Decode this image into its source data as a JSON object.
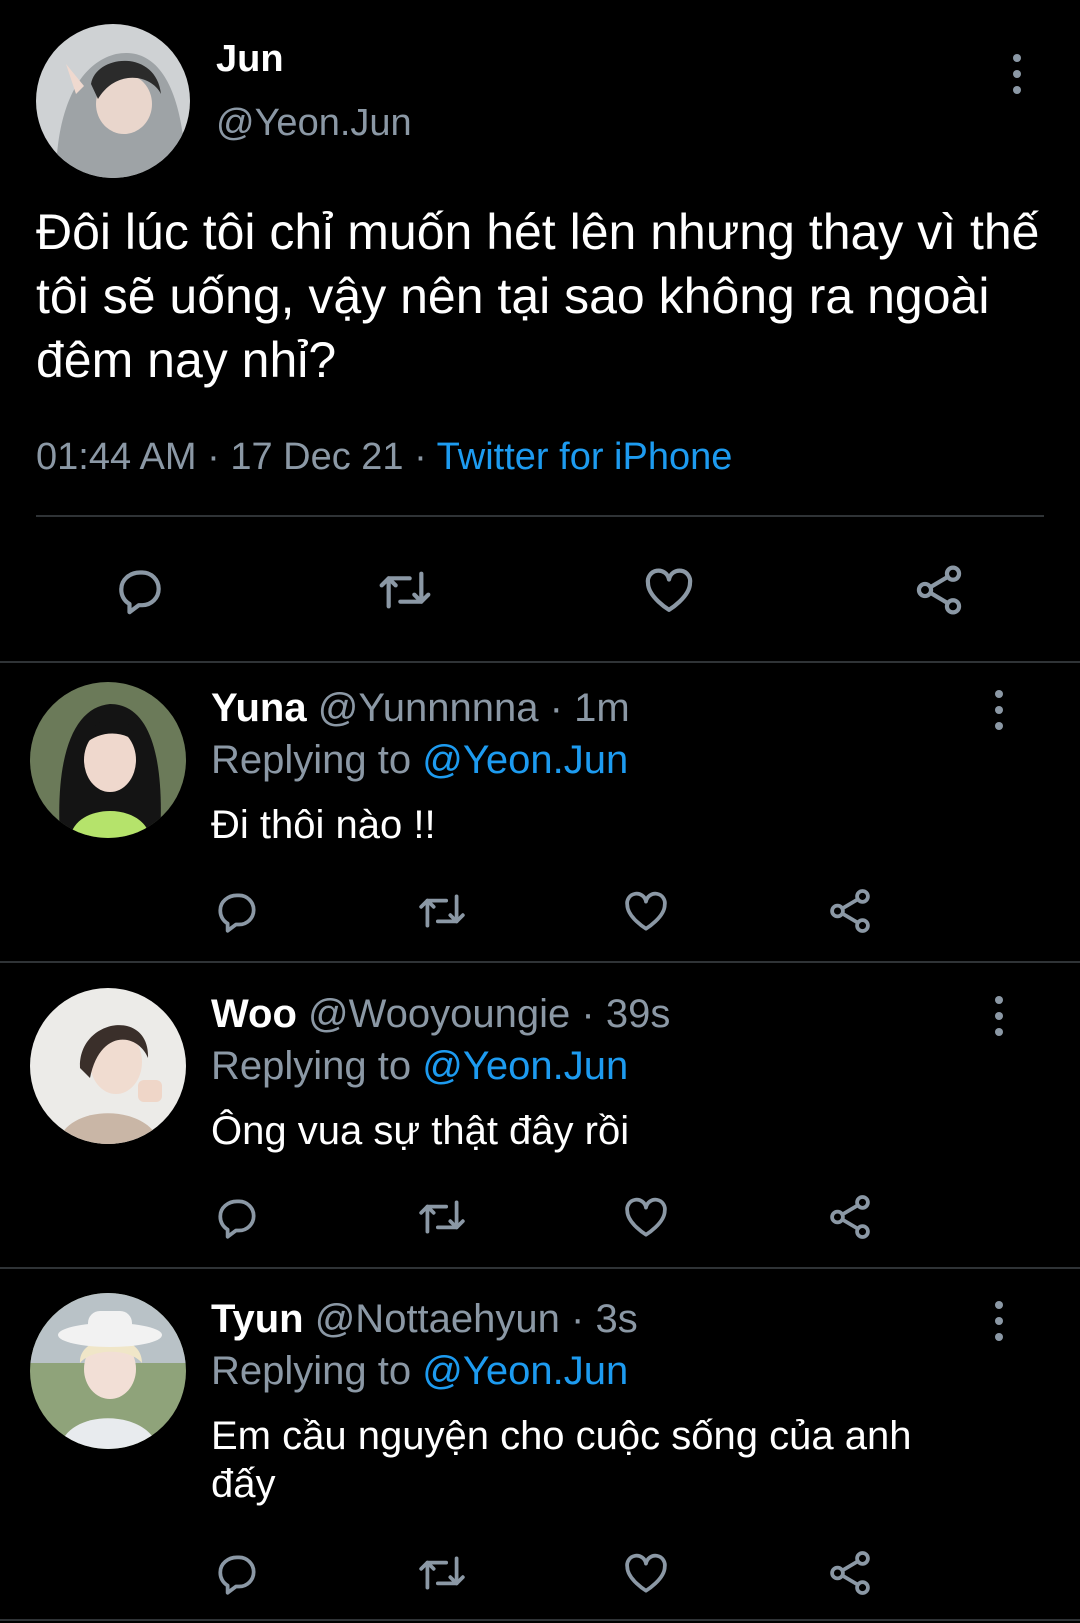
{
  "main_tweet": {
    "display_name": "Jun",
    "handle": "@Yeon.Jun",
    "text": "Đôi lúc tôi chỉ muốn hét lên nhưng thay vì thế tôi sẽ uống, vậy nên tại sao không ra ngoài đêm nay nhỉ?",
    "time": "01:44 AM",
    "sep1": " · ",
    "date": "17 Dec 21",
    "sep2": " · ",
    "source": "Twitter for iPhone"
  },
  "replies": [
    {
      "display_name": "Yuna",
      "handle": "@Yunnnnna",
      "age": "· 1m",
      "replying_label": "Replying to",
      "replying_to": "@Yeon.Jun",
      "text": "Đi thôi nào !!"
    },
    {
      "display_name": "Woo",
      "handle": "@Wooyoungie",
      "age": "· 39s",
      "replying_label": "Replying to",
      "replying_to": "@Yeon.Jun",
      "text": "Ông vua sự thật đây rồi"
    },
    {
      "display_name": "Tyun",
      "handle": "@Nottaehyun",
      "age": "· 3s",
      "replying_label": "Replying to",
      "replying_to": "@Yeon.Jun",
      "text": "Em cầu nguyện cho cuộc sống của anh đấy"
    }
  ],
  "icons": {
    "reply": "reply-icon",
    "retweet": "retweet-icon",
    "like": "heart-icon",
    "share": "share-icon",
    "more": "more-options-icon"
  },
  "colors": {
    "background": "#000000",
    "text": "#ffffff",
    "muted": "#8b98a5",
    "accent": "#1d9bf0",
    "divider": "#2f3336"
  }
}
